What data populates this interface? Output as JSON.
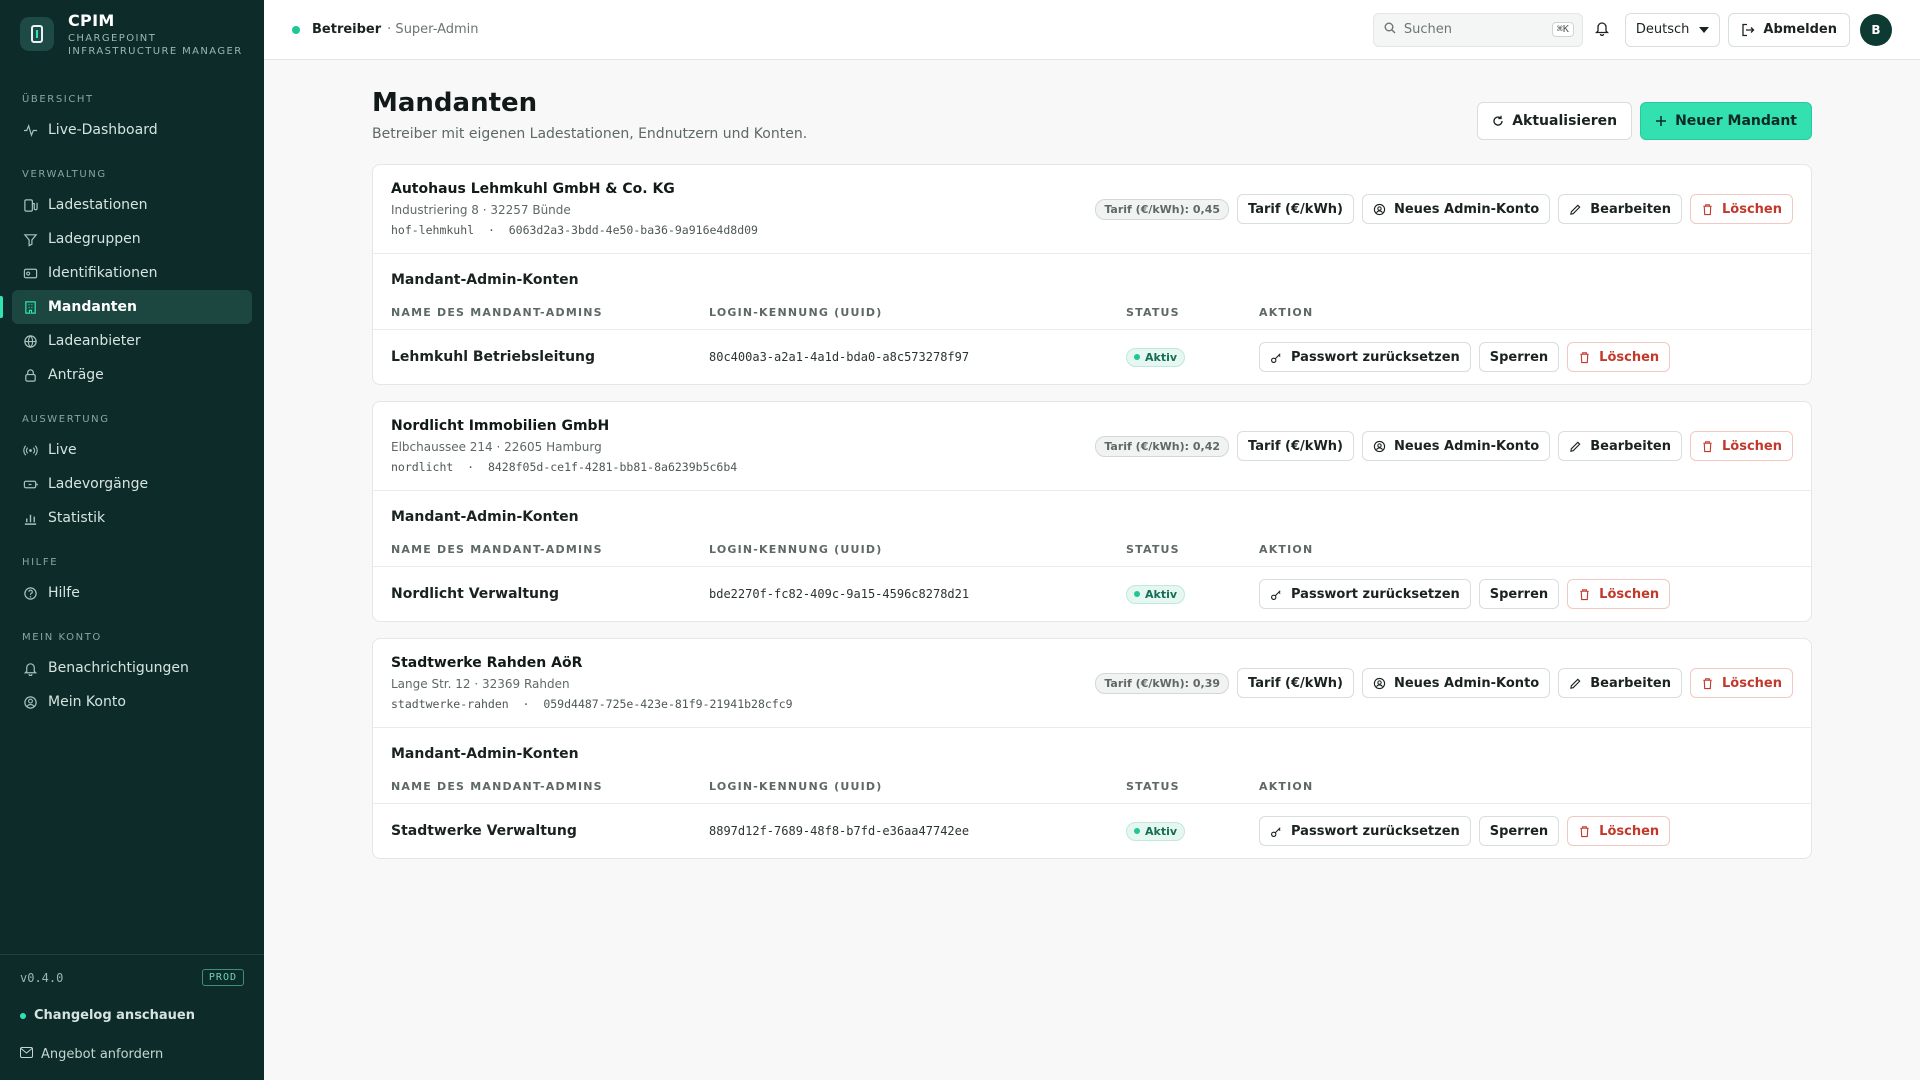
{
  "brand": {
    "name": "CPIM",
    "sub_line1": "CHARGEPOINT",
    "sub_line2": "INFRASTRUCTURE MANAGER"
  },
  "nav": {
    "sections": [
      {
        "title": "ÜBERSICHT",
        "items": [
          {
            "label": "Live-Dashboard",
            "icon": "activity-icon"
          }
        ]
      },
      {
        "title": "VERWALTUNG",
        "items": [
          {
            "label": "Ladestationen",
            "icon": "charger-icon"
          },
          {
            "label": "Ladegruppen",
            "icon": "group-icon"
          },
          {
            "label": "Identifikationen",
            "icon": "id-card-icon"
          },
          {
            "label": "Mandanten",
            "icon": "building-icon",
            "active": true
          },
          {
            "label": "Ladeanbieter",
            "icon": "globe-icon"
          },
          {
            "label": "Anträge",
            "icon": "lock-icon"
          }
        ]
      },
      {
        "title": "AUSWERTUNG",
        "items": [
          {
            "label": "Live",
            "icon": "broadcast-icon"
          },
          {
            "label": "Ladevorgänge",
            "icon": "battery-icon"
          },
          {
            "label": "Statistik",
            "icon": "bar-chart-icon"
          }
        ]
      },
      {
        "title": "HILFE",
        "items": [
          {
            "label": "Hilfe",
            "icon": "help-icon"
          }
        ]
      },
      {
        "title": "MEIN KONTO",
        "items": [
          {
            "label": "Benachrichtigungen",
            "icon": "bell-icon"
          },
          {
            "label": "Mein Konto",
            "icon": "user-circle-icon"
          }
        ]
      }
    ]
  },
  "footer": {
    "version": "v0.4.0",
    "env": "PROD",
    "changelog": "Changelog anschauen",
    "quote": "Angebot anfordern"
  },
  "topbar": {
    "role": "Betreiber",
    "role_sub": "· Super-Admin",
    "search_placeholder": "Suchen",
    "search_kbd": "⌘K",
    "language": "Deutsch",
    "logout": "Abmelden",
    "avatar": "B"
  },
  "page": {
    "title": "Mandanten",
    "description": "Betreiber mit eigenen Ladestationen, Endnutzern und Konten.",
    "refresh": "Aktualisieren",
    "new": "Neuer Mandant"
  },
  "labels": {
    "tariff_btn": "Tarif (€/kWh)",
    "new_admin": "Neues Admin-Konto",
    "edit": "Bearbeiten",
    "delete": "Löschen",
    "admins_title": "Mandant-Admin-Konten",
    "col_name": "NAME DES MANDANT-ADMINS",
    "col_login": "LOGIN-KENNUNG (UUID)",
    "col_status": "STATUS",
    "col_action": "AKTION",
    "reset_pw": "Passwort zurücksetzen",
    "lock": "Sperren",
    "row_delete": "Löschen"
  },
  "tenants": [
    {
      "name": "Autohaus Lehmkuhl GmbH & Co. KG",
      "address": "Industriering 8 · 32257 Bünde",
      "slug": "hof-lehmkuhl",
      "uuid": "6063d2a3-3bdd-4e50-ba36-9a916e4d8d09",
      "tariff": "Tarif (€/kWh): 0,45",
      "admins": [
        {
          "name": "Lehmkuhl Betriebsleitung",
          "login": "80c400a3-a2a1-4a1d-bda0-a8c573278f97",
          "status": "Aktiv"
        }
      ]
    },
    {
      "name": "Nordlicht Immobilien GmbH",
      "address": "Elbchaussee 214 · 22605 Hamburg",
      "slug": "nordlicht",
      "uuid": "8428f05d-ce1f-4281-bb81-8a6239b5c6b4",
      "tariff": "Tarif (€/kWh): 0,42",
      "admins": [
        {
          "name": "Nordlicht Verwaltung",
          "login": "bde2270f-fc82-409c-9a15-4596c8278d21",
          "status": "Aktiv"
        }
      ]
    },
    {
      "name": "Stadtwerke Rahden AöR",
      "address": "Lange Str. 12 · 32369 Rahden",
      "slug": "stadtwerke-rahden",
      "uuid": "059d4487-725e-423e-81f9-21941b28cfc9",
      "tariff": "Tarif (€/kWh): 0,39",
      "admins": [
        {
          "name": "Stadtwerke Verwaltung",
          "login": "8897d12f-7689-48f8-b7fd-e36aa47742ee",
          "status": "Aktiv"
        }
      ]
    }
  ],
  "colors": {
    "sidebar": "#0d2b28",
    "accent": "#33e0b0",
    "danger": "#c2392b"
  }
}
